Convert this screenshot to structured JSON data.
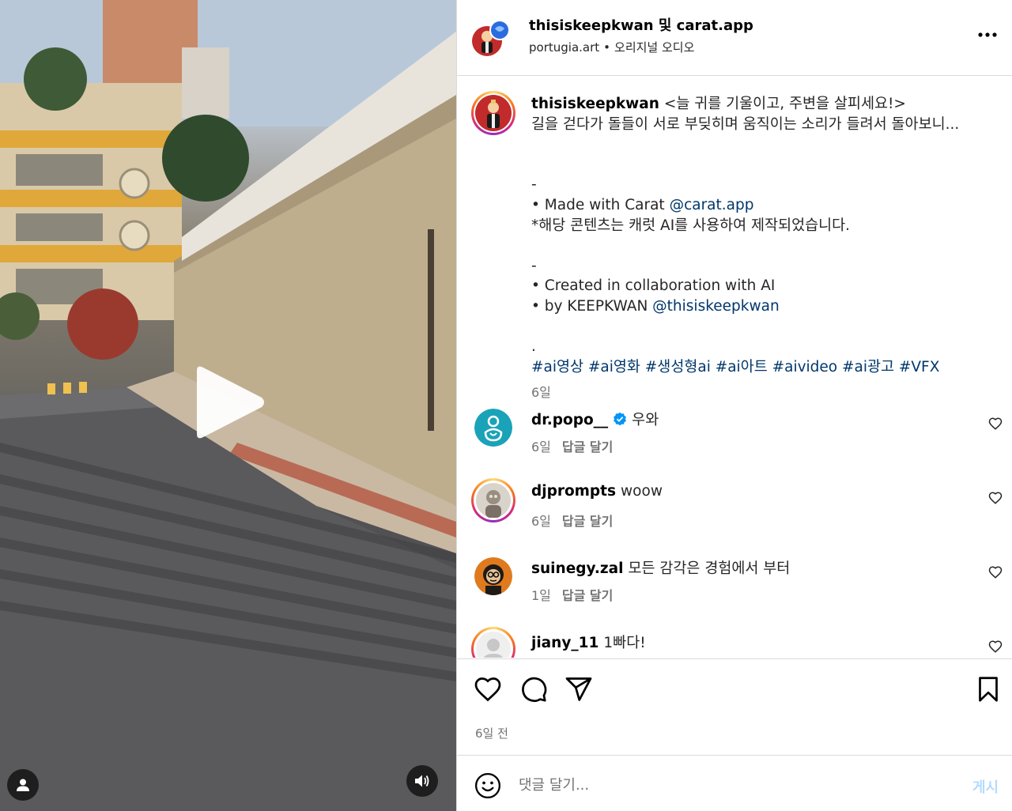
{
  "header": {
    "author": "thisiskeepkwan",
    "conjunction": "및",
    "collaborator": "carat.app",
    "location": "portugia.art",
    "audio": "오리지널 오디오"
  },
  "caption": {
    "username": "thisiskeepkwan",
    "title": "<늘 귀를 기울이고, 주변을 살피세요!>",
    "line2": "길을 걷다가 돌들이 서로 부딪히며 움직이는 소리가 들려서 돌아보니...",
    "sep1": "-",
    "made_with_prefix": "• Made with Carat ",
    "made_with_mention": "@carat.app",
    "notice": "*해당 콘텐츠는 캐럿 AI를 사용하여 제작되었습니다.",
    "sep2": "-",
    "collab_line": "• Created in collaboration with AI",
    "by_prefix": "• by KEEPKWAN ",
    "by_mention": "@thisiskeepkwan",
    "dot": ".",
    "hashtags": "#ai영상 #ai영화 #생성형ai #ai아트 #aivideo #ai광고 #VFX",
    "time": "6일"
  },
  "comments": [
    {
      "username": "dr.popo__",
      "verified": true,
      "text": "우와",
      "time": "6일",
      "reply": "답글 달기"
    },
    {
      "username": "djprompts",
      "verified": false,
      "text": "woow",
      "time": "6일",
      "reply": "답글 달기"
    },
    {
      "username": "suinegy.zal",
      "verified": false,
      "text": "모든 감각은 경험에서 부터",
      "time": "1일",
      "reply": "답글 달기"
    },
    {
      "username": "jiany_11",
      "verified": false,
      "text": "1빠다!",
      "time": "",
      "reply": ""
    }
  ],
  "footer": {
    "posted_ago": "6일 전",
    "comment_placeholder": "댓글 달기...",
    "post_button": "게시"
  },
  "colors": {
    "link": "#00376b",
    "muted": "#737373",
    "verified": "#0095f6",
    "post_disabled": "#b3dbff"
  },
  "icons": {
    "more": "more-options-icon",
    "like": "heart-icon",
    "comment": "comment-bubble-icon",
    "share": "paper-plane-icon",
    "save": "bookmark-icon",
    "emoji": "smiley-icon",
    "play": "play-icon",
    "sound": "speaker-icon",
    "user_tags": "person-icon"
  }
}
